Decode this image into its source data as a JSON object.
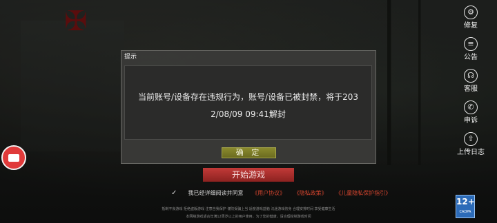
{
  "side_menu": {
    "items": [
      {
        "label": "修复",
        "icon": "gear-icon"
      },
      {
        "label": "公告",
        "icon": "notice-icon"
      },
      {
        "label": "客服",
        "icon": "headset-icon"
      },
      {
        "label": "申诉",
        "icon": "appeal-icon"
      },
      {
        "label": "上传日志",
        "icon": "upload-icon"
      }
    ]
  },
  "dialog": {
    "title": "提示",
    "message_line1": "当前账号/设备存在违规行为，账号/设备已被封禁，将于203",
    "message_line2": "2/08/09 09:41解封",
    "confirm_label": "确 定"
  },
  "start_button": {
    "label": "开始游戏"
  },
  "agreement": {
    "checkbox_label": "我已经详细阅读并同意",
    "links": [
      "《用户协议》",
      "《隐私政策》",
      "《儿童隐私保护指引》"
    ]
  },
  "notice": {
    "line1": "抵制不良游戏 拒绝盗版游戏 注意自我保护 谨防受骗上当 适度游戏益脑 沉迷游戏伤身 合理安排时间 享受健康生活",
    "line2": "本网络游戏适合年满12周岁以上的用户使用，为了您的健康，请合理控制游戏时间"
  },
  "age_rating": {
    "value": "12+",
    "caption": "CADPA"
  },
  "colors": {
    "accent_red": "#c23a38",
    "confirm_olive": "#8a8a2e",
    "link_red": "#d4452e"
  }
}
